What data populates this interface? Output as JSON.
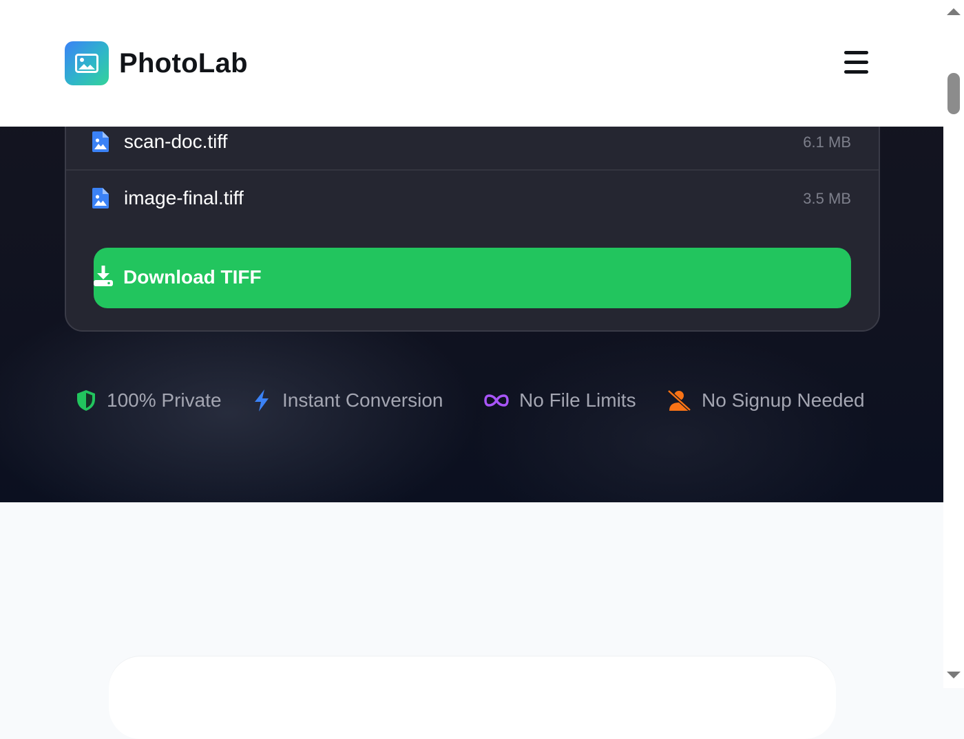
{
  "header": {
    "brand": "PhotoLab",
    "logo_icon": "image-icon",
    "menu_icon": "hamburger-menu-icon"
  },
  "files": [
    {
      "name": "scan-doc.tiff",
      "size": "6.1 MB",
      "icon": "file-image-icon"
    },
    {
      "name": "image-final.tiff",
      "size": "3.5 MB",
      "icon": "file-image-icon"
    }
  ],
  "download": {
    "label": "Download TIFF",
    "icon": "download-icon"
  },
  "features": [
    {
      "label": "100% Private",
      "icon": "shield-icon",
      "color": "#22c55e"
    },
    {
      "label": "Instant Conversion",
      "icon": "lightning-icon",
      "color": "#3b82f6"
    },
    {
      "label": "No File Limits",
      "icon": "infinity-icon",
      "color": "#a855f7"
    },
    {
      "label": "No Signup Needed",
      "icon": "user-slash-icon",
      "color": "#f97316"
    }
  ],
  "colors": {
    "accent_green": "#22c55e",
    "hero_bg": "#15161f",
    "card_bg": "#252631",
    "page_bg": "#f8fafc"
  }
}
